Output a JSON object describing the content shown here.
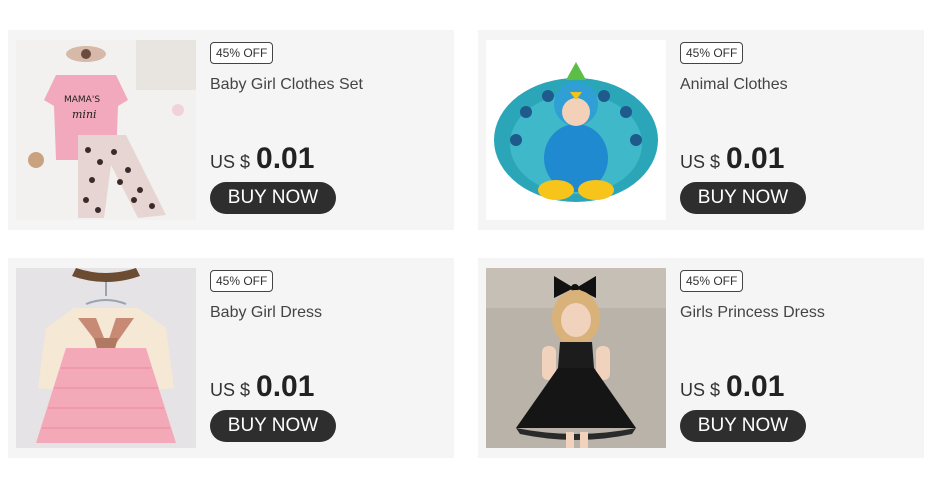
{
  "products": [
    {
      "discount": "45% OFF",
      "name": "Baby Girl Clothes Set",
      "currency": "US $",
      "price": "0.01",
      "cta": "BUY NOW",
      "image": "pink-leopard-outfit-photo"
    },
    {
      "discount": "45% OFF",
      "name": "Animal Clothes",
      "currency": "US $",
      "price": "0.01",
      "cta": "BUY NOW",
      "image": "peacock-costume-baby-photo"
    },
    {
      "discount": "45% OFF",
      "name": "Baby Girl Dress",
      "currency": "US $",
      "price": "0.01",
      "cta": "BUY NOW",
      "image": "pink-dress-on-hanger-photo"
    },
    {
      "discount": "45% OFF",
      "name": "Girls Princess Dress",
      "currency": "US $",
      "price": "0.01",
      "cta": "BUY NOW",
      "image": "black-tulle-dress-girl-photo"
    }
  ],
  "colors": {
    "card_bg": "#f5f5f5",
    "button_bg": "#2e2e2e",
    "button_text": "#ffffff"
  }
}
